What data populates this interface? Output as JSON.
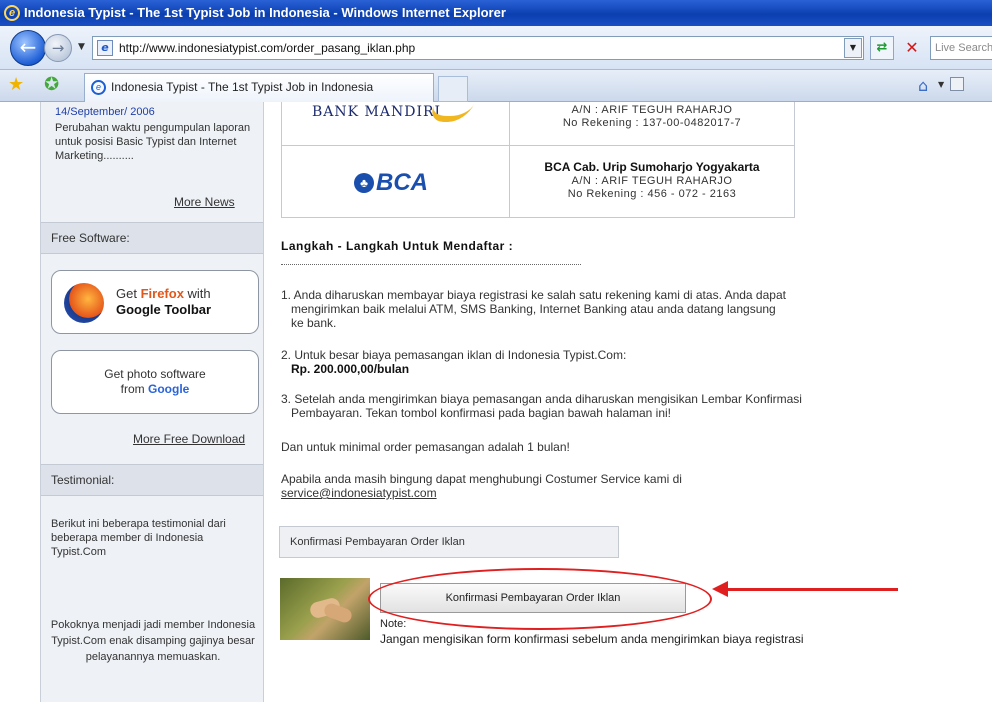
{
  "window": {
    "title": "Indonesia Typist - The 1st Typist Job in Indonesia - Windows Internet Explorer"
  },
  "address_bar": {
    "url": "http://www.indonesiatypist.com/order_pasang_iklan.php",
    "search_placeholder": "Live Search"
  },
  "tabs": [
    {
      "label": "Indonesia Typist - The 1st Typist Job in Indonesia"
    }
  ],
  "sidebar": {
    "news": {
      "date": "14/September/ 2006",
      "text": "Perubahan waktu pengumpulan laporan untuk posisi Basic Typist dan Internet Marketing..........",
      "more_label": "More News"
    },
    "free_software": {
      "heading": "Free Software:",
      "firefox_line1_prefix": "Get ",
      "firefox_name": "Firefox",
      "firefox_line1_suffix": " with",
      "firefox_line2": "Google Toolbar",
      "photo_line1": "Get photo software",
      "photo_line2_prefix": "from ",
      "photo_google": "Google",
      "more_label": "More Free Download"
    },
    "testimonial": {
      "heading": "Testimonial:",
      "intro": "Berikut ini beberapa testimonial dari beberapa member di Indonesia Typist.Com",
      "quote": "Pokoknya menjadi jadi member Indonesia Typist.Com enak disamping gajinya besar pelayanannya memuaskan."
    }
  },
  "banks": {
    "mandiri": {
      "logo_text": "BANK MANDIRI",
      "holder": "A/N  :  ARIF TEGUH RAHARJO",
      "account": "No Rekening : 137-00-0482017-7"
    },
    "bca": {
      "logo_text": "BCA",
      "branch": "BCA Cab. Urip Sumoharjo Yogyakarta",
      "holder": "A/N  :  ARIF TEGUH RAHARJO",
      "account": "No Rekening :   456 - 072 - 2163"
    }
  },
  "main": {
    "steps_title": "Langkah - Langkah Untuk Mendaftar :",
    "step1_a": "1. Anda diharuskan membayar biaya registrasi ke salah satu rekening kami di atas. Anda dapat",
    "step1_b": "mengirimkan baik melalui ATM, SMS Banking, Internet Banking atau anda datang langsung",
    "step1_c": "ke bank.",
    "step2_a": "2. Untuk besar biaya pemasangan iklan di Indonesia Typist.Com:",
    "step2_price": "Rp. 200.000,00/bulan",
    "step3_a": "3. Setelah anda mengirimkan biaya pemasangan anda diharuskan mengisikan Lembar Konfirmasi",
    "step3_b": "Pembayaran. Tekan tombol konfirmasi pada bagian bawah halaman ini!",
    "min_order": "Dan untuk minimal order pemasangan adalah 1 bulan!",
    "contact_text": "Apabila anda masih bingung dapat menghubungi Costumer Service kami di",
    "contact_email": "service@indonesiatypist.com",
    "confirm_heading": "Konfirmasi Pembayaran Order Iklan",
    "confirm_button": "Konfirmasi Pembayaran Order Iklan",
    "note_label": "Note:",
    "note_text": "Jangan mengisikan form konfirmasi sebelum anda mengirimkan biaya registrasi"
  },
  "colors": {
    "annotation": "#e02020",
    "link_blue": "#1f3fa8",
    "bca_blue": "#1a4fae"
  }
}
